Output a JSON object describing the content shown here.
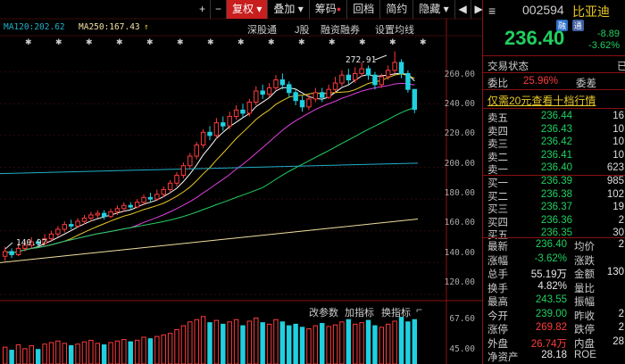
{
  "toolbar": {
    "plus": "+",
    "minus": "−",
    "adjust": "复权",
    "overlay": "叠加",
    "chips": "筹码",
    "replay": "回档",
    "brief": "简约",
    "hide": "隐藏",
    "prev": "◀",
    "next": "▶"
  },
  "ma": {
    "ma120": "MA120:202.62",
    "ma250": "MA250:167.43",
    "arrow": "↑"
  },
  "subtabs": [
    "深股通",
    "J股",
    "融资融券",
    "设置均线"
  ],
  "price_axis": [
    "260.00",
    "240.00",
    "220.00",
    "200.00",
    "180.00",
    "160.00",
    "140.00",
    "120.00"
  ],
  "volume_axis": {
    "top": "67.60",
    "mid": "45.00"
  },
  "annotations": {
    "high": "272.91",
    "low": "140.97"
  },
  "indicator_tabs": [
    "改参数",
    "加指标",
    "换指标"
  ],
  "colors": {
    "up": "#ff3b3b",
    "down": "#20d0e0",
    "ma5": "#ffffff",
    "ma10": "#e8c828",
    "ma20": "#e040e0",
    "ma60": "#20d060",
    "ma120": "#20b0c8",
    "ma250": "#f0e0a0"
  },
  "chart_data": {
    "type": "candlestick",
    "ylim": [
      120,
      280
    ],
    "candles": [
      {
        "o": 144,
        "c": 147,
        "h": 150,
        "l": 141
      },
      {
        "o": 147,
        "c": 145,
        "h": 149,
        "l": 143
      },
      {
        "o": 145,
        "c": 149,
        "h": 152,
        "l": 144
      },
      {
        "o": 149,
        "c": 151,
        "h": 154,
        "l": 147
      },
      {
        "o": 151,
        "c": 153,
        "h": 156,
        "l": 149
      },
      {
        "o": 153,
        "c": 152,
        "h": 155,
        "l": 150
      },
      {
        "o": 152,
        "c": 155,
        "h": 158,
        "l": 151
      },
      {
        "o": 155,
        "c": 158,
        "h": 160,
        "l": 153
      },
      {
        "o": 158,
        "c": 161,
        "h": 163,
        "l": 156
      },
      {
        "o": 161,
        "c": 164,
        "h": 166,
        "l": 159
      },
      {
        "o": 164,
        "c": 163,
        "h": 167,
        "l": 161
      },
      {
        "o": 163,
        "c": 166,
        "h": 168,
        "l": 162
      },
      {
        "o": 166,
        "c": 168,
        "h": 170,
        "l": 164
      },
      {
        "o": 168,
        "c": 170,
        "h": 172,
        "l": 166
      },
      {
        "o": 170,
        "c": 171,
        "h": 173,
        "l": 168
      },
      {
        "o": 171,
        "c": 169,
        "h": 173,
        "l": 167
      },
      {
        "o": 169,
        "c": 172,
        "h": 174,
        "l": 168
      },
      {
        "o": 172,
        "c": 174,
        "h": 176,
        "l": 170
      },
      {
        "o": 174,
        "c": 176,
        "h": 178,
        "l": 172
      },
      {
        "o": 176,
        "c": 175,
        "h": 178,
        "l": 173
      },
      {
        "o": 175,
        "c": 178,
        "h": 180,
        "l": 174
      },
      {
        "o": 178,
        "c": 181,
        "h": 183,
        "l": 176
      },
      {
        "o": 181,
        "c": 180,
        "h": 184,
        "l": 178
      },
      {
        "o": 180,
        "c": 183,
        "h": 186,
        "l": 179
      },
      {
        "o": 183,
        "c": 186,
        "h": 188,
        "l": 181
      },
      {
        "o": 186,
        "c": 190,
        "h": 192,
        "l": 184
      },
      {
        "o": 190,
        "c": 195,
        "h": 197,
        "l": 188
      },
      {
        "o": 195,
        "c": 201,
        "h": 203,
        "l": 193
      },
      {
        "o": 201,
        "c": 207,
        "h": 209,
        "l": 199
      },
      {
        "o": 207,
        "c": 214,
        "h": 216,
        "l": 205
      },
      {
        "o": 214,
        "c": 222,
        "h": 224,
        "l": 212
      },
      {
        "o": 222,
        "c": 220,
        "h": 226,
        "l": 217
      },
      {
        "o": 220,
        "c": 228,
        "h": 231,
        "l": 218
      },
      {
        "o": 228,
        "c": 226,
        "h": 232,
        "l": 223
      },
      {
        "o": 226,
        "c": 232,
        "h": 235,
        "l": 224
      },
      {
        "o": 232,
        "c": 236,
        "h": 239,
        "l": 230
      },
      {
        "o": 236,
        "c": 234,
        "h": 240,
        "l": 231
      },
      {
        "o": 234,
        "c": 241,
        "h": 243,
        "l": 232
      },
      {
        "o": 241,
        "c": 248,
        "h": 251,
        "l": 239
      },
      {
        "o": 248,
        "c": 246,
        "h": 252,
        "l": 243
      },
      {
        "o": 246,
        "c": 250,
        "h": 253,
        "l": 244
      },
      {
        "o": 250,
        "c": 255,
        "h": 258,
        "l": 248
      },
      {
        "o": 255,
        "c": 252,
        "h": 259,
        "l": 249
      },
      {
        "o": 252,
        "c": 247,
        "h": 254,
        "l": 244
      },
      {
        "o": 247,
        "c": 242,
        "h": 249,
        "l": 239
      },
      {
        "o": 242,
        "c": 238,
        "h": 245,
        "l": 235
      },
      {
        "o": 238,
        "c": 243,
        "h": 246,
        "l": 236
      },
      {
        "o": 243,
        "c": 247,
        "h": 250,
        "l": 241
      },
      {
        "o": 247,
        "c": 244,
        "h": 250,
        "l": 241
      },
      {
        "o": 244,
        "c": 249,
        "h": 252,
        "l": 243
      },
      {
        "o": 249,
        "c": 253,
        "h": 257,
        "l": 247
      },
      {
        "o": 253,
        "c": 258,
        "h": 261,
        "l": 251
      },
      {
        "o": 258,
        "c": 255,
        "h": 262,
        "l": 252
      },
      {
        "o": 255,
        "c": 259,
        "h": 263,
        "l": 253
      },
      {
        "o": 259,
        "c": 262,
        "h": 266,
        "l": 257
      },
      {
        "o": 262,
        "c": 258,
        "h": 264,
        "l": 255
      },
      {
        "o": 258,
        "c": 252,
        "h": 260,
        "l": 249
      },
      {
        "o": 252,
        "c": 257,
        "h": 259,
        "l": 250
      },
      {
        "o": 257,
        "c": 261,
        "h": 264,
        "l": 255
      },
      {
        "o": 261,
        "c": 266,
        "h": 272.91,
        "l": 259
      },
      {
        "o": 266,
        "c": 259,
        "h": 268,
        "l": 256
      },
      {
        "o": 259,
        "c": 249,
        "h": 261,
        "l": 247
      },
      {
        "o": 249,
        "c": 236.4,
        "h": 243.55,
        "l": 234
      }
    ],
    "volume_ylim": [
      0,
      67.6
    ],
    "volumes": [
      22,
      18,
      25,
      20,
      24,
      19,
      26,
      28,
      30,
      27,
      24,
      26,
      29,
      31,
      27,
      25,
      28,
      30,
      32,
      29,
      31,
      35,
      33,
      36,
      38,
      40,
      45,
      50,
      55,
      58,
      62,
      54,
      57,
      52,
      55,
      58,
      50,
      56,
      60,
      54,
      52,
      58,
      55,
      50,
      52,
      48,
      46,
      50,
      53,
      49,
      51,
      55,
      58,
      52,
      54,
      57,
      50,
      48,
      52,
      56,
      61,
      55,
      58
    ]
  },
  "quote": {
    "code": "002594",
    "name": "比亚迪",
    "badge1": "融",
    "badge2": "通",
    "price": "236.40",
    "change": "-8.89",
    "change_pct": "-3.62%",
    "status_label": "交易状态",
    "status_value": "已",
    "weibi_label": "委比",
    "weibi_value": "25.96%",
    "weicha_label": "委差",
    "promo": "仅需20元查看十档行情",
    "asks": [
      {
        "label": "卖五",
        "price": "236.44",
        "vol": "16"
      },
      {
        "label": "卖四",
        "price": "236.43",
        "vol": "10"
      },
      {
        "label": "卖三",
        "price": "236.42",
        "vol": "10"
      },
      {
        "label": "卖二",
        "price": "236.41",
        "vol": "10"
      },
      {
        "label": "卖一",
        "price": "236.40",
        "vol": "623"
      }
    ],
    "bids": [
      {
        "label": "买一",
        "price": "236.39",
        "vol": "985"
      },
      {
        "label": "买二",
        "price": "236.38",
        "vol": "102"
      },
      {
        "label": "买三",
        "price": "236.37",
        "vol": "19"
      },
      {
        "label": "买四",
        "price": "236.36",
        "vol": "2"
      },
      {
        "label": "买五",
        "price": "236.35",
        "vol": "30"
      }
    ],
    "stats": [
      {
        "l1": "最新",
        "v1": "236.40",
        "c1": "green",
        "l2": "均价",
        "v2": "2"
      },
      {
        "l1": "涨幅",
        "v1": "-3.62%",
        "c1": "green",
        "l2": "涨跌",
        "v2": ""
      },
      {
        "l1": "总手",
        "v1": "55.19万",
        "c1": "white",
        "l2": "金额",
        "v2": "130"
      },
      {
        "l1": "换手",
        "v1": "4.82%",
        "c1": "white",
        "l2": "量比",
        "v2": ""
      },
      {
        "l1": "最高",
        "v1": "243.55",
        "c1": "green",
        "l2": "振幅",
        "v2": ""
      },
      {
        "l1": "今开",
        "v1": "239.00",
        "c1": "green",
        "l2": "昨收",
        "v2": "2"
      },
      {
        "l1": "涨停",
        "v1": "269.82",
        "c1": "red",
        "l2": "跌停",
        "v2": "2"
      },
      {
        "l1": "外盘",
        "v1": "26.74万",
        "c1": "red",
        "l2": "内盘",
        "v2": "28"
      },
      {
        "l1": "净资产",
        "v1": "28.18",
        "c1": "white",
        "l2": "ROE",
        "v2": ""
      }
    ]
  }
}
